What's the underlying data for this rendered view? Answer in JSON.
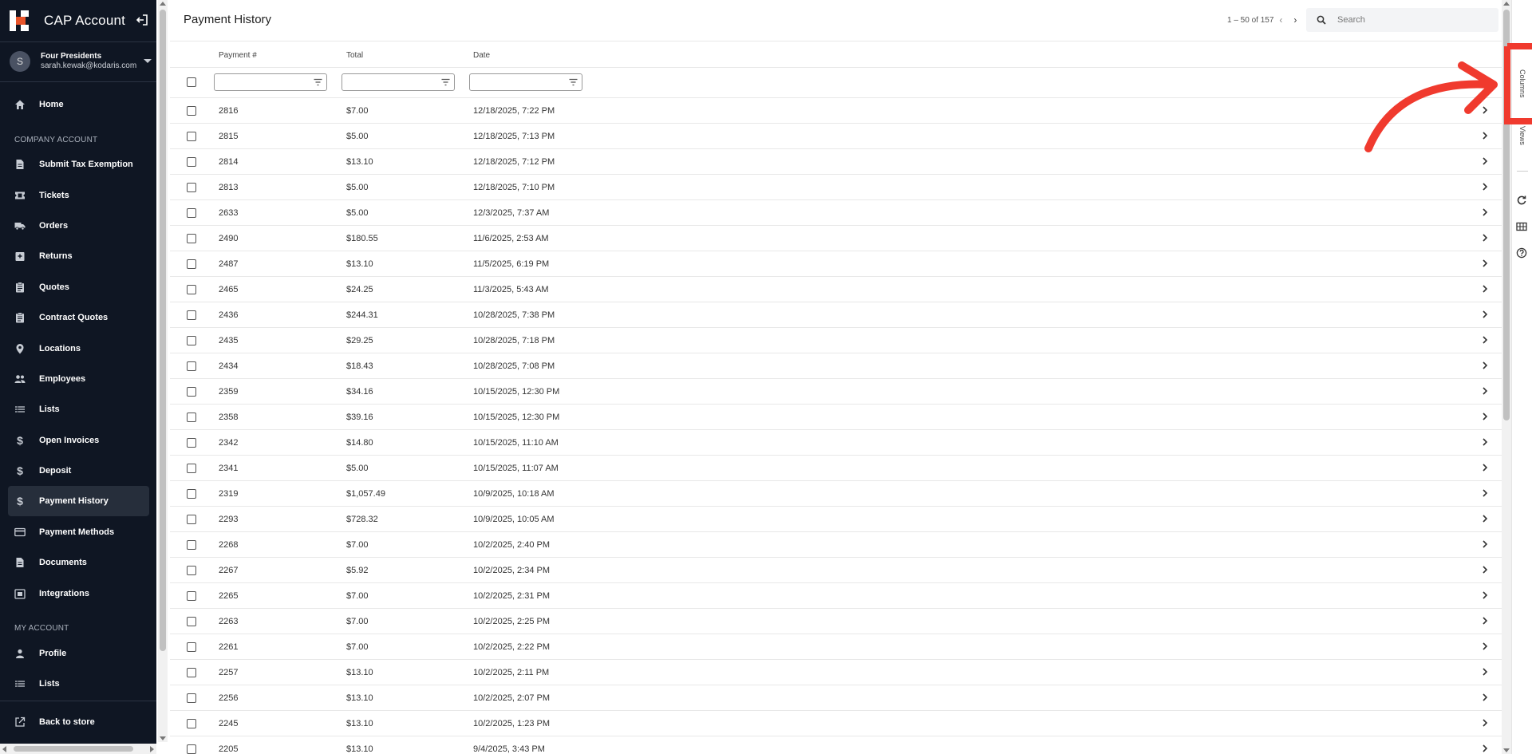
{
  "app": {
    "title": "CAP Account",
    "user": {
      "initial": "S",
      "name": "Four Presidents",
      "email": "sarah.kewak@kodaris.com"
    }
  },
  "sidebar": {
    "items": [
      {
        "label": "Home",
        "icon": "home-icon"
      },
      {
        "label": "Submit Tax Exemption",
        "icon": "document-icon"
      },
      {
        "label": "Tickets",
        "icon": "ticket-icon"
      },
      {
        "label": "Orders",
        "icon": "truck-icon"
      },
      {
        "label": "Returns",
        "icon": "return-box-icon"
      },
      {
        "label": "Quotes",
        "icon": "clipboard-icon"
      },
      {
        "label": "Contract Quotes",
        "icon": "clipboard-icon"
      },
      {
        "label": "Locations",
        "icon": "location-pin-icon"
      },
      {
        "label": "Employees",
        "icon": "people-icon"
      },
      {
        "label": "Lists",
        "icon": "list-icon"
      },
      {
        "label": "Open Invoices",
        "icon": "dollar-icon"
      },
      {
        "label": "Deposit",
        "icon": "dollar-icon"
      },
      {
        "label": "Payment History",
        "icon": "dollar-icon"
      },
      {
        "label": "Payment Methods",
        "icon": "credit-card-icon"
      },
      {
        "label": "Documents",
        "icon": "document-icon"
      },
      {
        "label": "Integrations",
        "icon": "integrations-icon"
      },
      {
        "label": "Profile",
        "icon": "person-icon"
      },
      {
        "label": "Lists",
        "icon": "list-icon"
      },
      {
        "label": "Back to store",
        "icon": "external-link-icon"
      }
    ],
    "sections": {
      "company": "COMPANY ACCOUNT",
      "my_account": "MY ACCOUNT"
    },
    "active_item": "Payment History"
  },
  "main": {
    "title": "Payment History",
    "pagination": "1 – 50 of 157",
    "search": {
      "placeholder": "Search",
      "value": ""
    },
    "columns": [
      "Payment #",
      "Total",
      "Date"
    ],
    "rows": [
      [
        "2816",
        "$7.00",
        "12/18/2025, 7:22 PM"
      ],
      [
        "2815",
        "$5.00",
        "12/18/2025, 7:13 PM"
      ],
      [
        "2814",
        "$13.10",
        "12/18/2025, 7:12 PM"
      ],
      [
        "2813",
        "$5.00",
        "12/18/2025, 7:10 PM"
      ],
      [
        "2633",
        "$5.00",
        "12/3/2025, 7:37 AM"
      ],
      [
        "2490",
        "$180.55",
        "11/6/2025, 2:53 AM"
      ],
      [
        "2487",
        "$13.10",
        "11/5/2025, 6:19 PM"
      ],
      [
        "2465",
        "$24.25",
        "11/3/2025, 5:43 AM"
      ],
      [
        "2436",
        "$244.31",
        "10/28/2025, 7:38 PM"
      ],
      [
        "2435",
        "$29.25",
        "10/28/2025, 7:18 PM"
      ],
      [
        "2434",
        "$18.43",
        "10/28/2025, 7:08 PM"
      ],
      [
        "2359",
        "$34.16",
        "10/15/2025, 12:30 PM"
      ],
      [
        "2358",
        "$39.16",
        "10/15/2025, 12:30 PM"
      ],
      [
        "2342",
        "$14.80",
        "10/15/2025, 11:10 AM"
      ],
      [
        "2341",
        "$5.00",
        "10/15/2025, 11:07 AM"
      ],
      [
        "2319",
        "$1,057.49",
        "10/9/2025, 10:18 AM"
      ],
      [
        "2293",
        "$728.32",
        "10/9/2025, 10:05 AM"
      ],
      [
        "2268",
        "$7.00",
        "10/2/2025, 2:40 PM"
      ],
      [
        "2267",
        "$5.92",
        "10/2/2025, 2:34 PM"
      ],
      [
        "2265",
        "$7.00",
        "10/2/2025, 2:31 PM"
      ],
      [
        "2263",
        "$7.00",
        "10/2/2025, 2:25 PM"
      ],
      [
        "2261",
        "$7.00",
        "10/2/2025, 2:22 PM"
      ],
      [
        "2257",
        "$13.10",
        "10/2/2025, 2:11 PM"
      ],
      [
        "2256",
        "$13.10",
        "10/2/2025, 2:07 PM"
      ],
      [
        "2245",
        "$13.10",
        "10/2/2025, 1:23 PM"
      ],
      [
        "2205",
        "$13.10",
        "9/4/2025, 3:43 PM"
      ]
    ]
  },
  "right_bar": {
    "tabs": [
      "Columns",
      "Views"
    ],
    "icons": [
      "refresh-icon",
      "grid-icon",
      "help-icon"
    ]
  },
  "colors": {
    "sidebar_bg": "#0f1623",
    "brand_accent": "#e8542a",
    "annotation_red": "#f03a2e"
  }
}
